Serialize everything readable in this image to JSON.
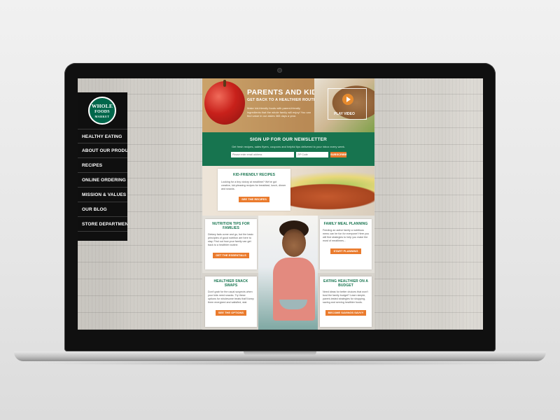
{
  "brand": {
    "logo_line1": "WHOLE",
    "logo_line2": "FOODS",
    "logo_line3": "MARKET"
  },
  "sidebar": {
    "items": [
      {
        "label": "HEALTHY EATING"
      },
      {
        "label": "ABOUT OUR PRODUCTS"
      },
      {
        "label": "RECIPES"
      },
      {
        "label": "ONLINE ORDERING"
      },
      {
        "label": "MISSION & VALUES"
      },
      {
        "label": "OUR BLOG"
      },
      {
        "label": "STORE DEPARTMENTS"
      }
    ]
  },
  "hero": {
    "title": "PARENTS AND KIDS",
    "subtitle": "GET BACK TO A HEALTHIER ROUTINE",
    "description": "Make kid-friendly foods with parent-friendly ingredients that the whole family will enjoy! You can find value in our aisles 365 days a year.",
    "video_label": "PLAY VIDEO"
  },
  "newsletter": {
    "title": "SIGN UP FOR OUR NEWSLETTER",
    "description": "Get fresh recipes, sales flyers, coupons and helpful tips delivered to your inbox every week.",
    "email_placeholder": "Please enter email address",
    "zip_placeholder": "ZIP Code",
    "button": "SUBSCRIBE"
  },
  "cards": {
    "kid_recipes": {
      "title": "KID-FRIENDLY RECIPES",
      "text": "Looking for a tiny victory at mealtime? We've got creative, kid-pleasing recipes for breakfast, lunch, dinner and snacks.",
      "button": "SEE THE RECIPES"
    },
    "nutrition": {
      "title": "NUTRITION TIPS FOR FAMILIES",
      "text": "Dietary fads come and go, but the basic principles of good nutrition are here to stay. Find out how your family can get back to a healthier routine.",
      "button": "GET THE ESSENTIALS"
    },
    "meal_planning": {
      "title": "FAMILY MEAL PLANNING",
      "text": "Feeding an active family a nutritious menu can be fun for everyone! Here you will find strategies to help you make the most of mealtimes...",
      "button": "START PLANNING"
    },
    "snack_swaps": {
      "title": "HEALTHIER SNACK SWAPS",
      "text": "Don't grab for the usual suspects when your kids need snacks. Try these options for wholesome treats that'll keep them energized and satisfied, stat.",
      "button": "SEE THE OPTIONS"
    },
    "budget": {
      "title": "EATING HEALTHIER ON A BUDGET",
      "text": "Need ideas for better choices that won't bust the family budget? Learn simple, parent-tested strategies for shopping, saving and serving healthier foods.",
      "button": "BECOME SAVINGS SAVVY"
    }
  }
}
